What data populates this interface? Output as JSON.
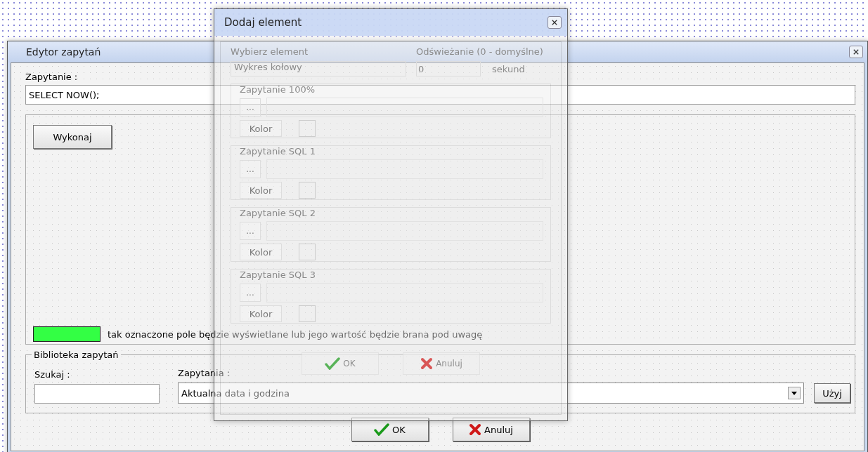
{
  "background_dialog": {
    "title": "Dodaj element",
    "element_label": "Wybierz element",
    "element_value": "Wykres kołowy",
    "refresh_label": "Odświeżanie (0 - domyślne)",
    "refresh_value": "0",
    "refresh_unit": "sekund",
    "query_groups": [
      {
        "title": "Zapytanie 100%",
        "browse_button": "...",
        "color_button": "Kolor"
      },
      {
        "title": "Zapytanie SQL 1",
        "browse_button": "...",
        "color_button": "Kolor"
      },
      {
        "title": "Zapytanie SQL 2",
        "browse_button": "...",
        "color_button": "Kolor"
      },
      {
        "title": "Zapytanie SQL 3",
        "browse_button": "...",
        "color_button": "Kolor"
      }
    ],
    "buttons": [
      {
        "label": "OK",
        "kind": "ok"
      },
      {
        "label": "Anuluj",
        "kind": "cancel"
      }
    ]
  },
  "window": {
    "title": "Edytor zapytań",
    "query_label": "Zapytanie :",
    "query_value": "SELECT NOW();",
    "run_button": "Wykonaj",
    "legend_text": "tak oznaczone pole będzie wyświetlane lub jego wartość będzie brana pod uwagę",
    "library": {
      "title": "Biblioteka zapytań",
      "search_label": "Szukaj :",
      "queries_label": "Zapytania :",
      "queries_value": "Aktualna data i godzina",
      "use_button": "Użyj"
    },
    "buttons": [
      {
        "label": "OK",
        "kind": "ok"
      },
      {
        "label": "Anuluj",
        "kind": "cancel"
      }
    ]
  }
}
